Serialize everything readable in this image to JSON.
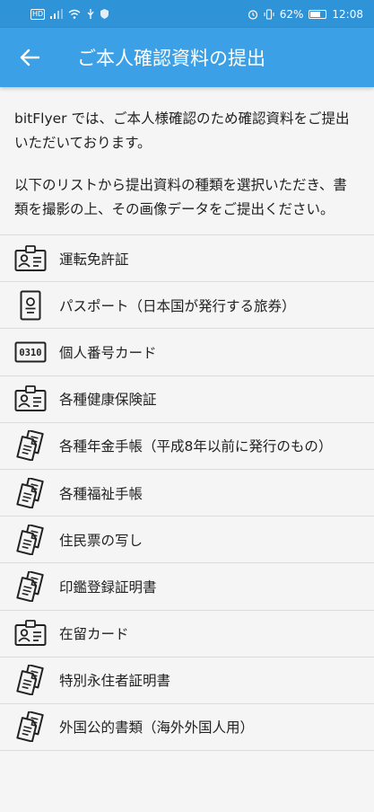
{
  "status_bar": {
    "left_icons": [
      "hd-icon",
      "signal-icon",
      "wifi-icon",
      "usb-icon",
      "shield-icon"
    ],
    "hd_text": "HD",
    "battery": "62%",
    "time": "12:08"
  },
  "app_bar": {
    "title": "ご本人確認資料の提出",
    "background": "#3ba0e6"
  },
  "intro": {
    "paragraph1": "bitFlyer では、ご本人様確認のため確認資料をご提出いただいております。",
    "paragraph2": "以下のリストから提出資料の種類を選択いただき、書類を撮影の上、その画像データをご提出ください。"
  },
  "documents": [
    {
      "label": "運転免許証",
      "icon": "id-card-icon"
    },
    {
      "label": "パスポート（日本国が発行する旅券）",
      "icon": "passport-icon"
    },
    {
      "label": "個人番号カード",
      "icon": "number-card-icon"
    },
    {
      "label": "各種健康保険証",
      "icon": "id-card-icon"
    },
    {
      "label": "各種年金手帳（平成8年以前に発行のもの）",
      "icon": "documents-icon"
    },
    {
      "label": "各種福祉手帳",
      "icon": "documents-icon"
    },
    {
      "label": "住民票の写し",
      "icon": "documents-icon"
    },
    {
      "label": "印鑑登録証明書",
      "icon": "documents-icon"
    },
    {
      "label": "在留カード",
      "icon": "id-card-icon"
    },
    {
      "label": "特別永住者証明書",
      "icon": "documents-icon"
    },
    {
      "label": "外国公的書類（海外外国人用）",
      "icon": "documents-icon"
    }
  ],
  "number_card_text": "0310"
}
